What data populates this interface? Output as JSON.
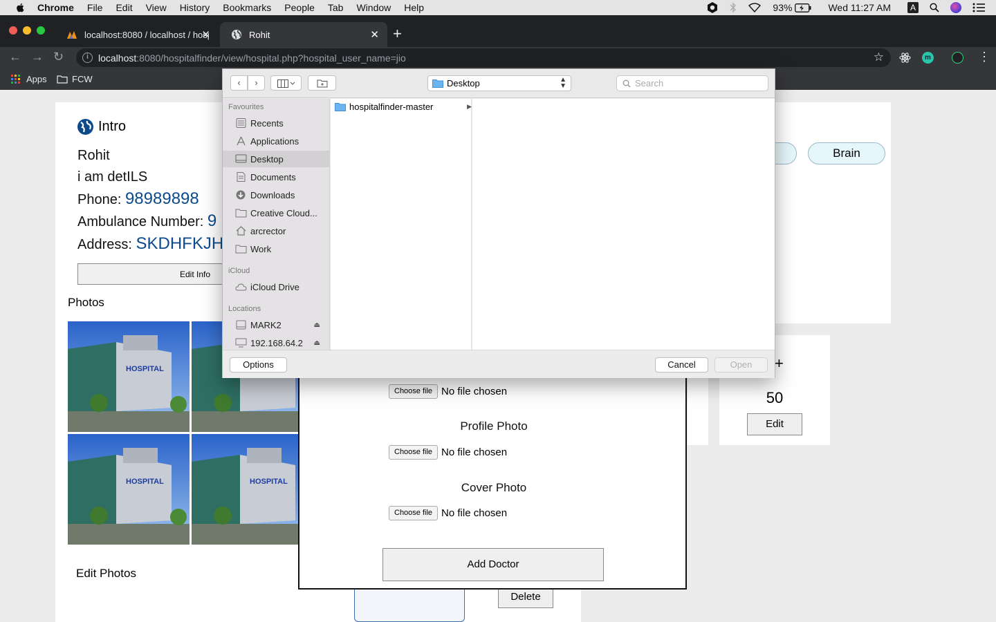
{
  "menubar": {
    "items": [
      "Chrome",
      "File",
      "Edit",
      "View",
      "History",
      "Bookmarks",
      "People",
      "Tab",
      "Window",
      "Help"
    ],
    "battery": "93%",
    "clock": "Wed 11:27 AM",
    "input_source": "A"
  },
  "browser": {
    "tabs": [
      {
        "title": "localhost:8080 / localhost / hosp",
        "icon": "phpmyadmin-icon"
      },
      {
        "title": "Rohit",
        "icon": "globe-icon"
      }
    ],
    "url_host": "localhost",
    "url_rest": ":8080/hospitalfinder/view/hospital.php?hospital_user_name=jio",
    "bookmarks": [
      "Apps",
      "FCW"
    ]
  },
  "intro": {
    "heading": "Intro",
    "name": "Rohit",
    "description": "i am detILS",
    "phone_label": "Phone: ",
    "phone_value": "98989898",
    "ambulance_label": "Ambulance Number: ",
    "ambulance_value": "9",
    "address_label": "Address: ",
    "address_value": "SKDHFKJHS",
    "edit_button": "Edit Info",
    "photos_heading": "Photos",
    "edit_photos": "Edit Photos"
  },
  "specialties": {
    "partial_pill": "-",
    "brain_pill": "Brain"
  },
  "beds": {
    "add_symbol": "+",
    "count": "50",
    "edit_button": "Edit"
  },
  "doctor_card": {
    "delete_button": "Delete"
  },
  "modal": {
    "file_rows": [
      {
        "button": "Choose file",
        "status": "No file chosen"
      },
      {
        "label": "Profile Photo",
        "button": "Choose file",
        "status": "No file chosen"
      },
      {
        "label": "Cover Photo",
        "button": "Choose file",
        "status": "No file chosen"
      }
    ],
    "submit": "Add Doctor"
  },
  "file_dialog": {
    "location": "Desktop",
    "search_placeholder": "Search",
    "sidebar": {
      "favourites_heading": "Favourites",
      "favourites": [
        "Recents",
        "Applications",
        "Desktop",
        "Documents",
        "Downloads",
        "Creative Cloud...",
        "arcrector",
        "Work"
      ],
      "icloud_heading": "iCloud",
      "icloud": [
        "iCloud Drive"
      ],
      "locations_heading": "Locations",
      "locations": [
        "MARK2",
        "192.168.64.2"
      ]
    },
    "selected_sidebar_item": "Desktop",
    "column_items": [
      "hospitalfinder-master"
    ],
    "options_button": "Options",
    "cancel_button": "Cancel",
    "open_button": "Open"
  },
  "colors": {
    "link_blue": "#0d4a8c",
    "chrome_dark": "#202124",
    "pill_bg": "#e6f7fb"
  }
}
